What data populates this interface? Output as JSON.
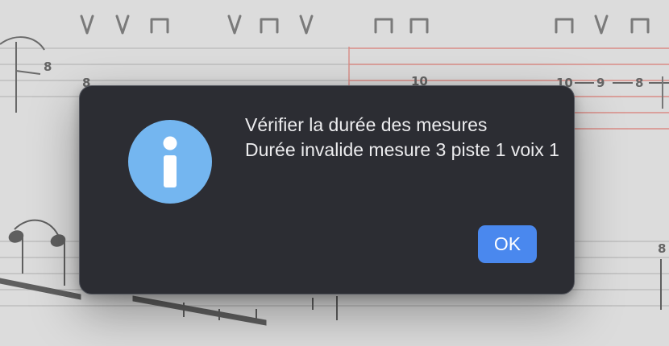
{
  "background_score": {
    "description_icon": "guitar-tab-score-icon",
    "stroke_marks": [
      "V",
      "V",
      "⊓",
      "V",
      "⊓",
      "V",
      "⊓",
      "⊓",
      "⊓",
      "V",
      "⊓"
    ],
    "tab_numbers": [
      "8",
      "8",
      "10",
      "10",
      "9",
      "8",
      "8"
    ]
  },
  "dialog": {
    "icon": "info-icon",
    "title": "Vérifier la durée des mesures",
    "message": "Durée invalide mesure 3 piste 1 voix 1",
    "ok_label": "OK"
  },
  "colors": {
    "dialog_bg": "#2c2d33",
    "accent": "#4a88ee",
    "icon_circle": "#74b6f0",
    "highlight_line": "#d98c86"
  }
}
